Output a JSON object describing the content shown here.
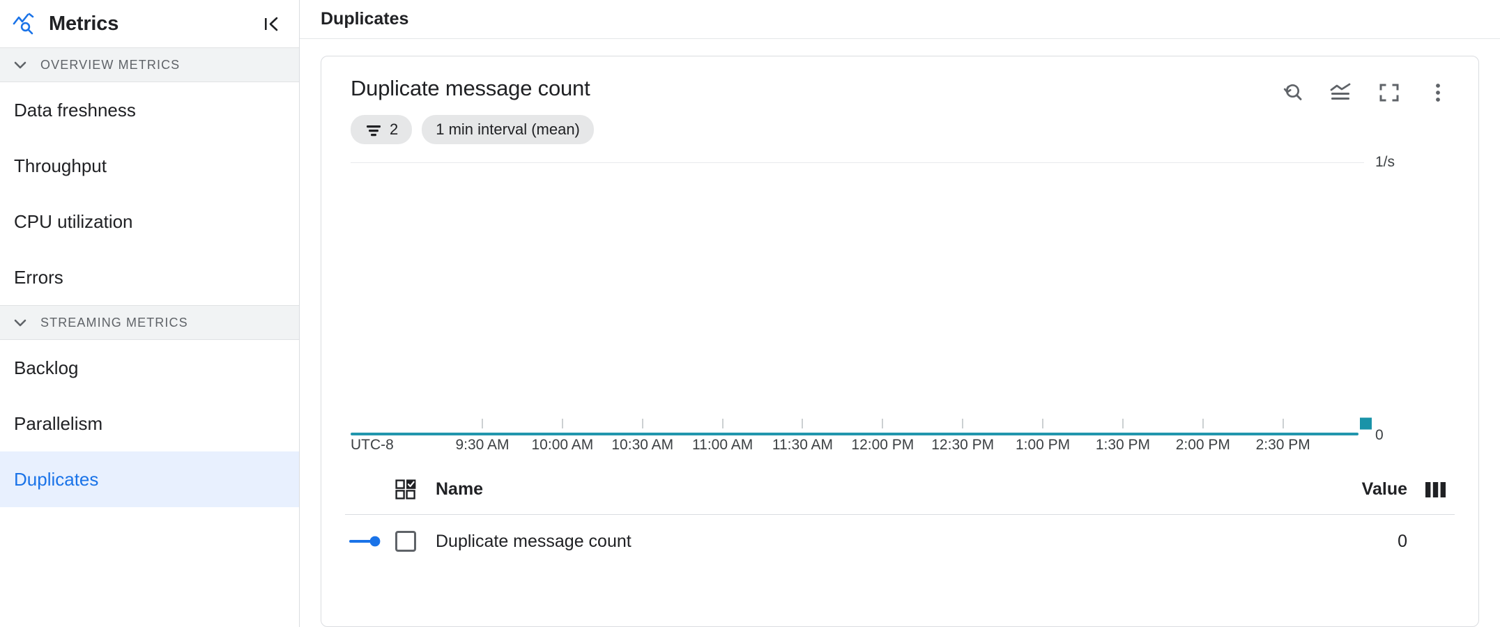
{
  "sidebar": {
    "title": "Metrics",
    "icon": "metrics-search-icon",
    "collapse_icon": "collapse-panel-icon",
    "sections": [
      {
        "label": "OVERVIEW METRICS",
        "items": [
          {
            "label": "Data freshness",
            "selected": false
          },
          {
            "label": "Throughput",
            "selected": false
          },
          {
            "label": "CPU utilization",
            "selected": false
          },
          {
            "label": "Errors",
            "selected": false
          }
        ]
      },
      {
        "label": "STREAMING METRICS",
        "items": [
          {
            "label": "Backlog",
            "selected": false
          },
          {
            "label": "Parallelism",
            "selected": false
          },
          {
            "label": "Duplicates",
            "selected": true
          }
        ]
      }
    ]
  },
  "header": {
    "title": "Duplicates"
  },
  "card": {
    "title": "Duplicate message count",
    "chips": [
      {
        "icon": "filter-list-icon",
        "label": "2"
      },
      {
        "icon": null,
        "label": "1 min interval (mean)"
      }
    ],
    "tools": [
      {
        "name": "reset-zoom-icon",
        "label": "Reset zoom"
      },
      {
        "name": "chart-type-icon",
        "label": "Chart type"
      },
      {
        "name": "fullscreen-icon",
        "label": "Fullscreen"
      },
      {
        "name": "more-options-icon",
        "label": "More options"
      }
    ]
  },
  "chart_data": {
    "type": "line",
    "title": "Duplicate message count",
    "xlabel": "",
    "ylabel": "1/s",
    "timezone": "UTC-8",
    "x": [
      "9:30 AM",
      "10:00 AM",
      "10:30 AM",
      "11:00 AM",
      "11:30 AM",
      "12:00 PM",
      "12:30 PM",
      "1:00 PM",
      "1:30 PM",
      "2:00 PM",
      "2:30 PM"
    ],
    "tick_labels": [
      "9:30 AM",
      "10:00 AM",
      "10:30 AM",
      "11:00 AM",
      "11:30 AM",
      "12:00 PM",
      "12:30 PM",
      "1:00 PM",
      "1:30 PM",
      "2:00 PM",
      "2:30 PM"
    ],
    "y_tick_labels": [
      "1/s",
      "0"
    ],
    "ylim": [
      0,
      1
    ],
    "grid": true,
    "legend_position": "bottom-table",
    "series": [
      {
        "name": "Duplicate message count",
        "color": "#2196ad",
        "values": [
          0,
          0,
          0,
          0,
          0,
          0,
          0,
          0,
          0,
          0,
          0
        ],
        "end_value": "0"
      }
    ]
  },
  "legend": {
    "columns": {
      "name": "Name",
      "value": "Value"
    },
    "select_all_icon": "grid-select-icon",
    "columns_icon": "column-settings-icon",
    "rows": [
      {
        "name": "Duplicate message count",
        "value": "0",
        "swatch_color": "#1a73e8",
        "checked": false
      }
    ]
  }
}
